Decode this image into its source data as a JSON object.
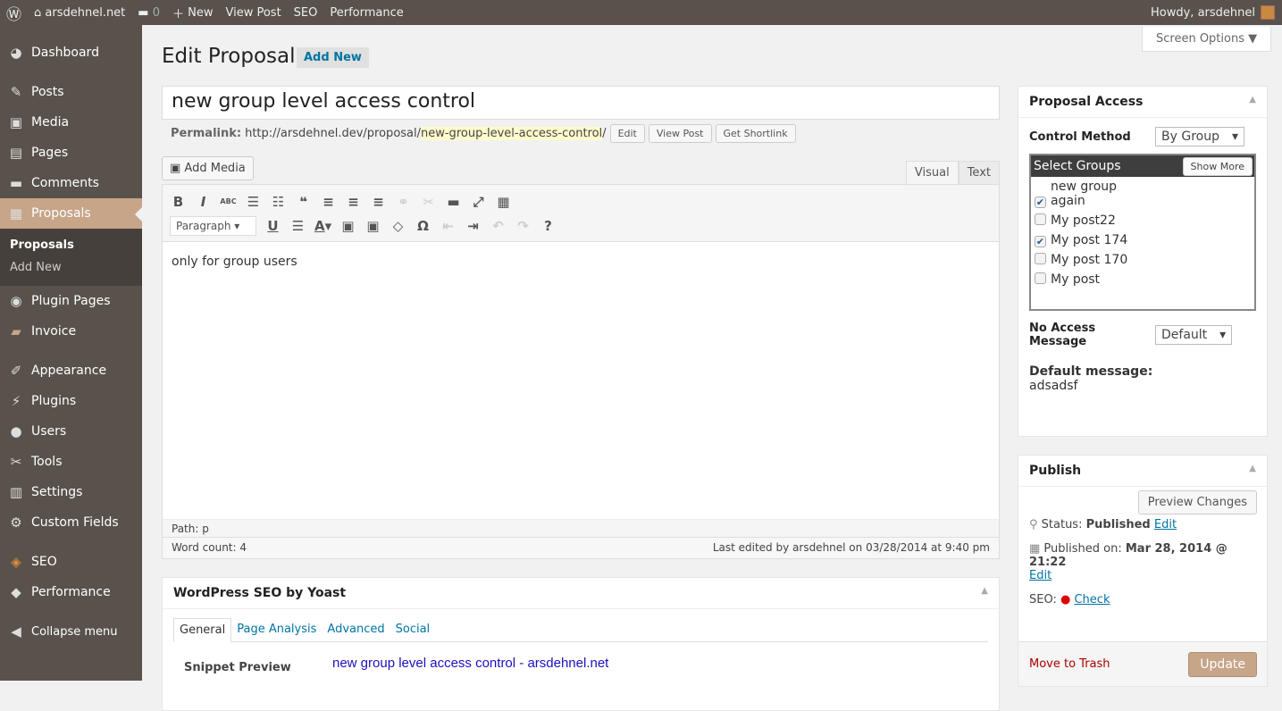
{
  "adminbar": {
    "site": "arsdehnel.net",
    "comments": "0",
    "new": "New",
    "view_post": "View Post",
    "seo": "SEO",
    "performance": "Performance",
    "howdy": "Howdy, arsdehnel"
  },
  "sidebar": {
    "items": [
      {
        "label": "Dashboard",
        "icon": "◕"
      },
      {
        "label": "Posts",
        "icon": "✎"
      },
      {
        "label": "Media",
        "icon": "▣"
      },
      {
        "label": "Pages",
        "icon": "▤"
      },
      {
        "label": "Comments",
        "icon": "▬"
      },
      {
        "label": "Proposals",
        "icon": "▦"
      },
      {
        "label": "Plugin Pages",
        "icon": "◉"
      },
      {
        "label": "Invoice",
        "icon": "▰"
      },
      {
        "label": "Appearance",
        "icon": "✐"
      },
      {
        "label": "Plugins",
        "icon": "⚡"
      },
      {
        "label": "Users",
        "icon": "●"
      },
      {
        "label": "Tools",
        "icon": "✂"
      },
      {
        "label": "Settings",
        "icon": "▥"
      },
      {
        "label": "Custom Fields",
        "icon": "⚙"
      },
      {
        "label": "SEO",
        "icon": "◈"
      },
      {
        "label": "Performance",
        "icon": "◆"
      }
    ],
    "sub": [
      "Proposals",
      "Add New"
    ],
    "collapse": "Collapse menu"
  },
  "screen_options": "Screen Options ▼",
  "page": {
    "title": "Edit Proposal",
    "add_new": "Add New",
    "post_title": "new group level access control",
    "permalink_label": "Permalink:",
    "permalink_base": "http://arsdehnel.dev/proposal/",
    "permalink_slug": "new-group-level-access-control",
    "permalink_end": "/",
    "edit": "Edit",
    "view_post": "View Post",
    "shortlink": "Get Shortlink",
    "add_media": "Add Media",
    "tab_visual": "Visual",
    "tab_text": "Text",
    "format": "Paragraph",
    "content": "only for group users",
    "path": "Path: p",
    "word_count": "Word count: 4",
    "last_edited": "Last edited by arsdehnel on 03/28/2014 at 9:40 pm"
  },
  "seo": {
    "title": "WordPress SEO by Yoast",
    "tabs": [
      "General",
      "Page Analysis",
      "Advanced",
      "Social"
    ],
    "snippet_label": "Snippet Preview",
    "snippet_title": "new group level access control - arsdehnel.net"
  },
  "access": {
    "title": "Proposal Access",
    "control_label": "Control Method",
    "control_value": "By Group",
    "select_groups": "Select Groups",
    "show_more": "Show More",
    "groups": [
      {
        "label": "new group again",
        "checked": true
      },
      {
        "label": "My post22",
        "checked": false
      },
      {
        "label": "My post 174",
        "checked": true
      },
      {
        "label": "My post 170",
        "checked": false
      },
      {
        "label": "My post",
        "checked": false
      }
    ],
    "no_access_label": "No Access Message",
    "no_access_value": "Default",
    "default_label": "Default message:",
    "default_value": "adsadsf"
  },
  "publish": {
    "title": "Publish",
    "preview": "Preview Changes",
    "status_label": "Status:",
    "status": "Published",
    "edit": "Edit",
    "published_label": "Published on:",
    "published": "Mar 28, 2014 @ 21:22",
    "seo_label": "SEO:",
    "check": "Check",
    "trash": "Move to Trash",
    "update": "Update"
  }
}
